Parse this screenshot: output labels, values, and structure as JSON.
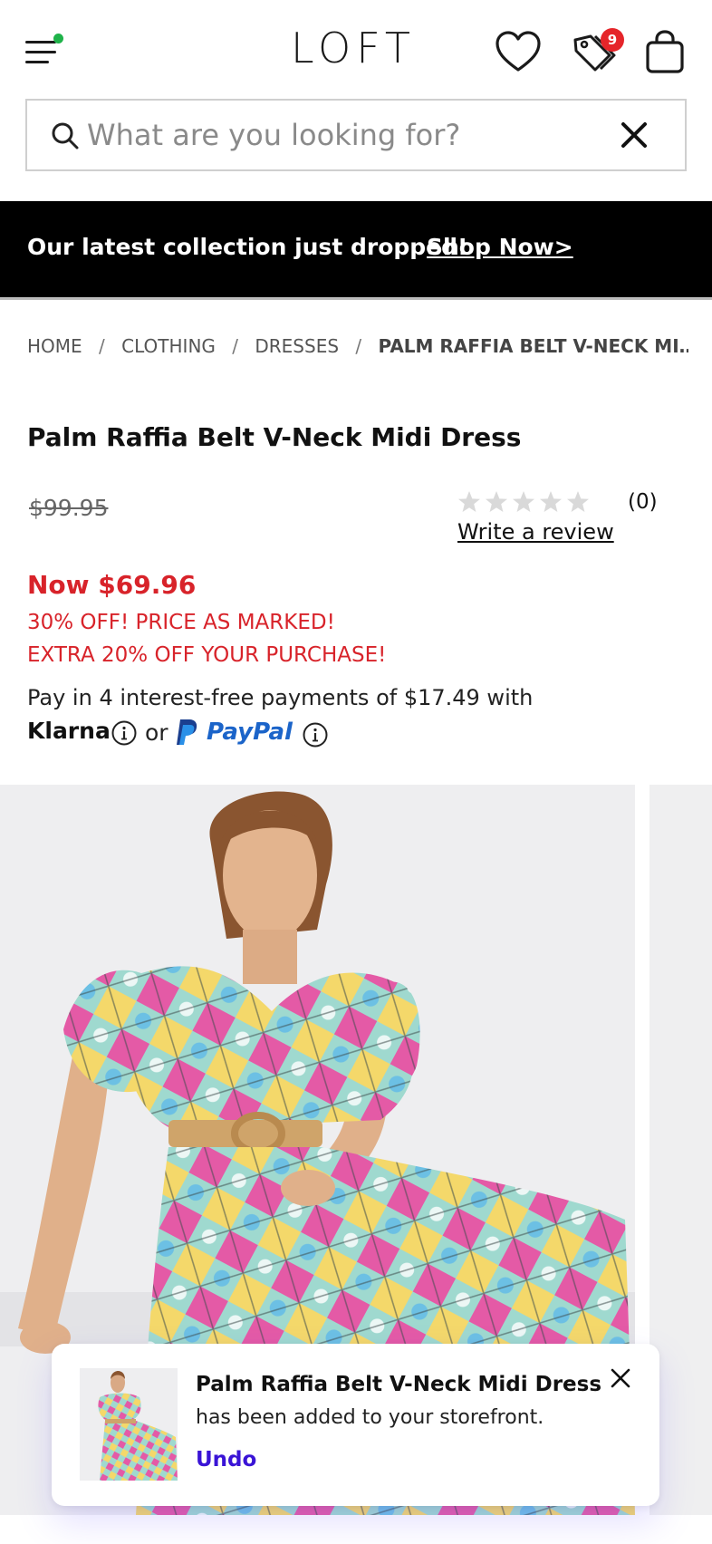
{
  "header": {
    "logo": "LOFT",
    "badge_count": "9",
    "notification_dot_color": "#1fb34a",
    "badge_color": "#e5252a",
    "icons": [
      "menu-icon",
      "heart-icon",
      "tag-icon",
      "shopping-bag-icon"
    ]
  },
  "search": {
    "placeholder": "What are you looking for?",
    "value": ""
  },
  "promo": {
    "message": "Our latest collection just dropped!",
    "link_label": "Shop Now>"
  },
  "breadcrumb": {
    "items": [
      "HOME",
      "CLOTHING",
      "DRESSES"
    ],
    "separator": "/",
    "current": "PALM RAFFIA BELT V-NECK MIDI DRESS"
  },
  "product": {
    "title": "Palm Raffia Belt V-Neck Midi Dress",
    "original_price": "$99.95",
    "rating": {
      "stars_filled": 0,
      "stars_total": 5,
      "count_label": "(0)",
      "write_review_label": "Write a review"
    },
    "now_price": "Now $69.96",
    "promo_line_1": "30% OFF! PRICE AS MARKED!",
    "promo_line_2": "EXTRA 20% OFF YOUR PURCHASE!",
    "payment_text": "Pay in 4 interest-free payments of $17.49 with",
    "klarna_label": "Klarna",
    "or_label": "or",
    "paypal_label": "PayPal",
    "price_color": "#d8232a"
  },
  "toast": {
    "title": "Palm Raffia Belt V-Neck Midi Dress",
    "message": "has been added to your storefront.",
    "undo_label": "Undo",
    "undo_color": "#3a14d6"
  }
}
